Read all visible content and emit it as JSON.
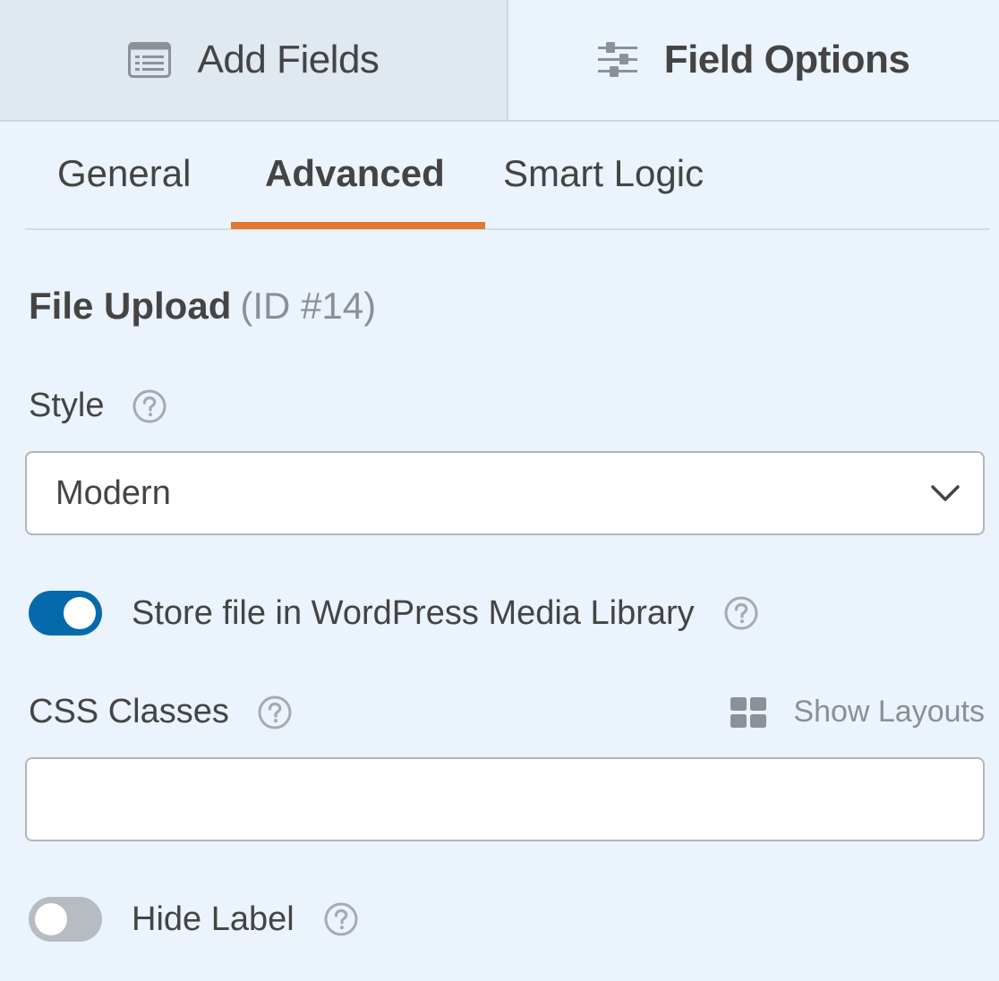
{
  "top_tabs": {
    "add_fields": {
      "label": "Add Fields",
      "icon": "list-icon"
    },
    "field_options": {
      "label": "Field Options",
      "icon": "sliders-icon"
    }
  },
  "sub_tabs": {
    "general": "General",
    "advanced": "Advanced",
    "smart_logic": "Smart Logic",
    "active": "Advanced"
  },
  "field": {
    "name": "File Upload",
    "id_text": "(ID #14)"
  },
  "style": {
    "label": "Style",
    "selected": "Modern"
  },
  "store_media": {
    "label": "Store file in WordPress Media Library",
    "enabled": true
  },
  "css_classes": {
    "label": "CSS Classes",
    "value": "",
    "placeholder": "",
    "show_layouts": "Show Layouts"
  },
  "hide_label": {
    "label": "Hide Label",
    "enabled": false
  },
  "colors": {
    "accent_orange": "#e27730",
    "toggle_on": "#056aab",
    "toggle_off": "#b6bcc2",
    "background": "#ebf3fc"
  }
}
